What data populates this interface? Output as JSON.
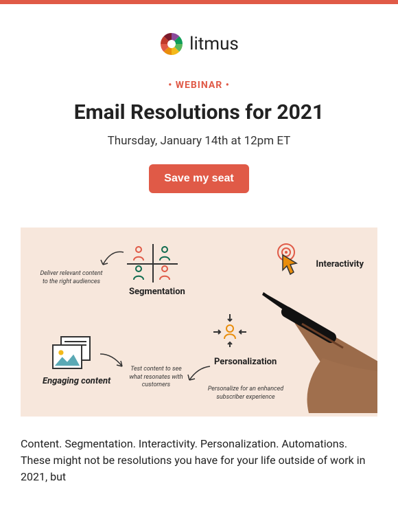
{
  "brand": {
    "name": "litmus"
  },
  "colors": {
    "accent": "#e05a47",
    "hero_bg": "#f7e7dc"
  },
  "header": {
    "eyebrow": "• WEBINAR •",
    "title": "Email Resolutions for 2021",
    "subtitle": "Thursday, January 14th at 12pm ET",
    "cta": "Save my seat"
  },
  "hero": {
    "segmentation": {
      "label": "Segmentation",
      "caption": "Deliver relevant content to the right audiences"
    },
    "engaging": {
      "label": "Engaging content",
      "caption": "Test content to see what resonates with customers"
    },
    "personalization": {
      "label": "Personalization",
      "caption": "Personalize for an enhanced subscriber experience"
    },
    "interactivity": {
      "label": "Interactivity"
    }
  },
  "body": {
    "paragraph": "Content. Segmentation. Interactivity. Personalization. Automations. These might not be resolutions you have for your life outside of work in 2021, but"
  }
}
